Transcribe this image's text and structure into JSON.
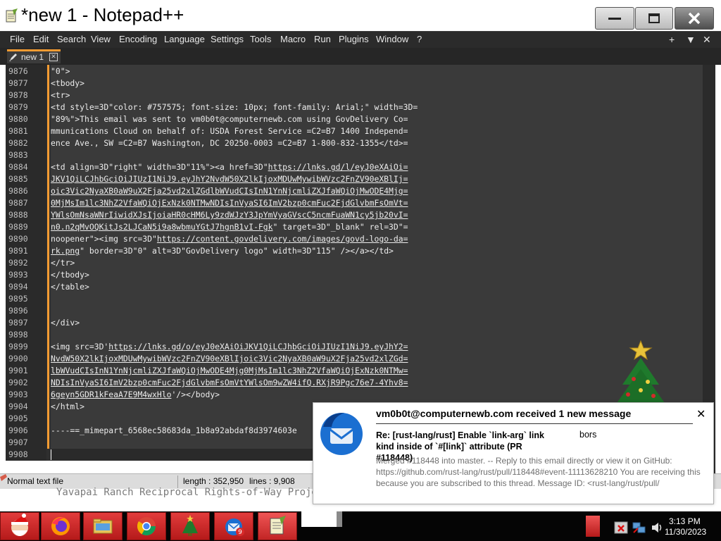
{
  "window": {
    "title": "*new 1 - Notepad++"
  },
  "menu": {
    "items": [
      "File",
      "Edit",
      "Search",
      "View",
      "Encoding",
      "Language",
      "Settings",
      "Tools",
      "Macro",
      "Run",
      "Plugins",
      "Window",
      "?"
    ],
    "right": [
      "+",
      "▼",
      "✕"
    ]
  },
  "tab": {
    "label": "new 1"
  },
  "editor": {
    "lines": [
      {
        "num": "9876",
        "text": "\"0\">"
      },
      {
        "num": "9877",
        "text": "<tbody>"
      },
      {
        "num": "9878",
        "text": "<tr>"
      },
      {
        "num": "9879",
        "text": "<td style=3D\"color: #757575; font-size: 10px; font-family: Arial;\" width=3D="
      },
      {
        "num": "9880",
        "text": "\"89%\">This email was sent to vm0b0t@computernewb.com using GovDelivery Co="
      },
      {
        "num": "9881",
        "text": "mmunications Cloud on behalf of: USDA Forest Service =C2=B7 1400 Independ="
      },
      {
        "num": "9882",
        "text": "ence Ave., SW =C2=B7 Washington, DC 20250-0003 =C2=B7 1-800-832-1355</td>="
      },
      {
        "num": "9883",
        "text": ""
      },
      {
        "num": "9884",
        "text": "<td align=3D\"right\" width=3D\"11%\"><a href=3D\"",
        "link": "https://lnks.gd/l/eyJ0eXAiOi="
      },
      {
        "num": "9885",
        "text": "",
        "link": "JKV1QiLCJhbGciOiJIUzI1NiJ9.eyJhY2NvdW50X2lkIjoxMDUwMywibWVzc2FnZV90eXBlIj="
      },
      {
        "num": "9886",
        "text": "",
        "link": "oic3Vic2NyaXB0aW9uX2Fja25vd2xlZGdlbWVudCIsInN1YnNjcmliZXJfaWQiOjMwODE4Mjg="
      },
      {
        "num": "9887",
        "text": "",
        "link": "0MjMsIm1lc3NhZ2VfaWQiOjExNzk0NTMwNDIsInVyaSI6ImV2bzp0cmFuc2FjdGlvbmFsOmVt="
      },
      {
        "num": "9888",
        "text": "",
        "link": "YWlsOmNsaWNrIiwidXJsIjoiaHR0cHM6Ly9zdWJzY3JpYmVyaGVscC5ncmFuaWN1cy5jb20vI="
      },
      {
        "num": "9889",
        "text": "",
        "link": "n0.n2qMvOQKitJs2LJCaN5i9a8wbmuYGtJ7hgnB1vI-Fgk",
        "tail": "\" target=3D\"_blank\" rel=3D\"="
      },
      {
        "num": "9890",
        "text": "noopener\"><img src=3D\"",
        "link": "https://content.govdelivery.com/images/govd-logo-da="
      },
      {
        "num": "9891",
        "text": "",
        "link": "rk.png",
        "tail": "\" border=3D\"0\" alt=3D\"GovDelivery logo\" width=3D\"115\" /></a></td>"
      },
      {
        "num": "9892",
        "text": "</tr>"
      },
      {
        "num": "9893",
        "text": "</tbody>"
      },
      {
        "num": "9894",
        "text": "</table>"
      },
      {
        "num": "9895",
        "text": ""
      },
      {
        "num": "9896",
        "text": ""
      },
      {
        "num": "9897",
        "text": "</div>"
      },
      {
        "num": "9898",
        "text": ""
      },
      {
        "num": "9899",
        "text": "<img src=3D'",
        "link": "https://lnks.gd/o/eyJ0eXAiOiJKV1QiLCJhbGciOiJIUzI1NiJ9.eyJhY2="
      },
      {
        "num": "9900",
        "text": "",
        "link": "NvdW50X2lkIjoxMDUwMywibWVzc2FnZV90eXBlIjoic3Vic2NyaXB0aW9uX2Fja25vd2xlZGd="
      },
      {
        "num": "9901",
        "text": "",
        "link": "lbWVudCIsInN1YnNjcmliZXJfaWQiOjMwODE4Mjg0MjMsIm1lc3NhZ2VfaWQiOjExNzk0NTMw="
      },
      {
        "num": "9902",
        "text": "",
        "link": "NDIsInVyaSI6ImV2bzp0cmFuc2FjdGlvbmFsOmVtYWlsOm9wZW4ifQ.RXjR9Pgc76e7-4Yhv8="
      },
      {
        "num": "9903",
        "text": "",
        "link": "6geyn5GDR1kFeaA7E9M4wxHlo",
        "tail": "'/></body>"
      },
      {
        "num": "9904",
        "text": "</html>"
      },
      {
        "num": "9905",
        "text": ""
      },
      {
        "num": "9906",
        "text": "----==_mimepart_6568ec58683da_1b8a92abdaf8d3974603e"
      },
      {
        "num": "9907",
        "text": ""
      },
      {
        "num": "9908",
        "text": ""
      }
    ]
  },
  "status": {
    "mode": "Normal text file",
    "length": "length : 352,950",
    "lines": "lines : 9,908"
  },
  "background": {
    "text": "Yavapai Ranch Reciprocal Rights-of-Way Project"
  },
  "notification": {
    "title": "vm0b0t@computernewb.com received 1 new message",
    "subject": "Re: [rust-lang/rust] Enable `link-arg` link kind inside of `#[link]` attribute (PR #118448)",
    "from": "bors",
    "body": "Merged #118448 into master. -- Reply to this email directly or view it on GitHub: https://github.com/rust-lang/rust/pull/118448#event-11113628210 You are receiving this because you are subscribed to this thread. Message ID: <rust-lang/rust/pull/",
    "close": "✕"
  },
  "clock": {
    "time": "3:13 PM",
    "date": "11/30/2023"
  },
  "taskbar": {
    "badge": "9"
  },
  "colors": {
    "accent_orange": "#f49b32",
    "editor_bg": "#3a3a3a",
    "taskbar_red": "#c22525",
    "thunderbird_blue": "#1b6fd1"
  }
}
